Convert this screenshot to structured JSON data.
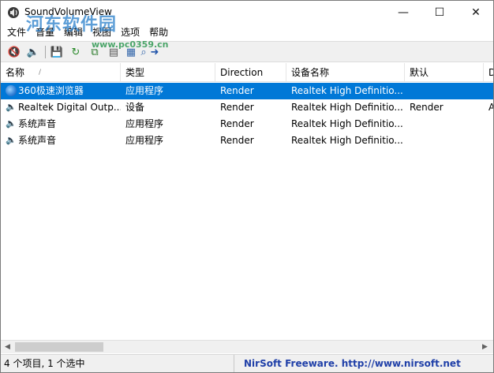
{
  "window": {
    "title": "SoundVolumeView",
    "minimize_glyph": "—",
    "maximize_glyph": "☐",
    "close_glyph": "✕"
  },
  "watermark": {
    "text": "河东软件园",
    "url": "www.pc0359.cn"
  },
  "menu": {
    "items": [
      "文件",
      "音量",
      "编辑",
      "视图",
      "选项",
      "帮助"
    ]
  },
  "toolbar": {
    "icons": [
      {
        "name": "mute-icon",
        "glyph": "🔇",
        "color": "#cc3333"
      },
      {
        "name": "unmute-icon",
        "glyph": "🔈",
        "color": "#555555"
      },
      {
        "name": "save-icon",
        "glyph": "💾",
        "color": "#2255aa"
      },
      {
        "name": "refresh-icon",
        "glyph": "↻",
        "color": "#2a8a2a"
      },
      {
        "name": "copy-icon",
        "glyph": "⧉",
        "color": "#2a7a2a"
      },
      {
        "name": "properties-icon",
        "glyph": "▤",
        "color": "#555555"
      },
      {
        "name": "html-report-icon",
        "glyph": "▦",
        "color": "#3366aa"
      },
      {
        "name": "find-icon",
        "glyph": "⌕",
        "color": "#3366aa"
      },
      {
        "name": "exit-icon",
        "glyph": "➜",
        "color": "#2255aa"
      }
    ]
  },
  "table": {
    "columns": [
      "名称",
      "类型",
      "Direction",
      "设备名称",
      "默认",
      "D"
    ],
    "sort_indicator": "/",
    "rows": [
      {
        "icon": "browser-icon",
        "name": "360极速浏览器",
        "type": "应用程序",
        "direction": "Render",
        "device": "Realtek High Definitio...",
        "default": "",
        "extra": "",
        "selected": true
      },
      {
        "icon": "speaker-icon",
        "name": "Realtek Digital Outp...",
        "type": "设备",
        "direction": "Render",
        "device": "Realtek High Definitio...",
        "default": "Render",
        "extra": "A",
        "selected": false
      },
      {
        "icon": "speaker-icon",
        "name": "系统声音",
        "type": "应用程序",
        "direction": "Render",
        "device": "Realtek High Definitio...",
        "default": "",
        "extra": "",
        "selected": false
      },
      {
        "icon": "speaker-icon",
        "name": "系统声音",
        "type": "应用程序",
        "direction": "Render",
        "device": "Realtek High Definitio...",
        "default": "",
        "extra": "",
        "selected": false
      }
    ]
  },
  "scrollbar": {
    "left_glyph": "◀",
    "right_glyph": "▶"
  },
  "status": {
    "items_text": "4 个项目, 1 个选中",
    "credit_text": "NirSoft Freeware.  http://www.nirsoft.net"
  },
  "colors": {
    "selection": "#0078d7",
    "credit": "#1f3fa8"
  }
}
